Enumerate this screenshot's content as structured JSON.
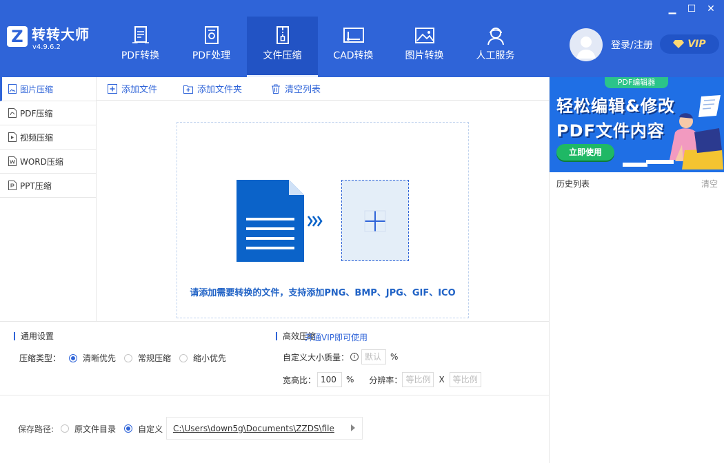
{
  "app": {
    "title": "转转大师",
    "version": "v4.9.6.2",
    "logo_letter": "Z"
  },
  "window_controls": {
    "minimize": "▁",
    "maximize": "☐",
    "close": "✕"
  },
  "nav": [
    {
      "label": "PDF转换",
      "icon": "pdf-convert-icon"
    },
    {
      "label": "PDF处理",
      "icon": "pdf-process-icon"
    },
    {
      "label": "文件压缩",
      "icon": "file-compress-icon",
      "active": true
    },
    {
      "label": "CAD转换",
      "icon": "cad-icon"
    },
    {
      "label": "图片转换",
      "icon": "image-convert-icon"
    },
    {
      "label": "人工服务",
      "icon": "service-icon"
    }
  ],
  "user": {
    "login_label": "登录/注册",
    "vip_label": "VIP"
  },
  "sidebar": [
    {
      "label": "图片压缩",
      "active": true
    },
    {
      "label": "PDF压缩"
    },
    {
      "label": "视频压缩"
    },
    {
      "label": "WORD压缩"
    },
    {
      "label": "PPT压缩"
    }
  ],
  "toolbar": {
    "add_file": "添加文件",
    "add_folder": "添加文件夹",
    "clear_list": "清空列表"
  },
  "dropzone": {
    "hint": "请添加需要转换的文件，支持添加PNG、BMP、JPG、GIF、ICO"
  },
  "settings": {
    "general_title": "通用设置",
    "compress_type_label": "压缩类型：",
    "options": [
      "清晰优先",
      "常规压缩",
      "缩小优先"
    ],
    "selected_option": "清晰优先",
    "efficient_title": "高效压缩",
    "vip_link": "开通VIP即可使用",
    "custom_size_label": "自定义大小质量：",
    "custom_size_placeholder": "默认",
    "percent": "%",
    "ratio_label": "宽高比：",
    "ratio_value": "100",
    "resolution_label": "分辨率：",
    "res_placeholder_w": "等比例",
    "res_x": "X",
    "res_placeholder_h": "等比例"
  },
  "save": {
    "label": "保存路径:",
    "option_original": "原文件目录",
    "option_custom": "自定义",
    "selected": "自定义",
    "path": "C:\\Users\\down5g\\Documents\\ZZDS\\file"
  },
  "banner": {
    "tag": "PDF编辑器",
    "line1": "轻松编辑&修改",
    "line2": "PDF文件内容",
    "button": "立即使用"
  },
  "history": {
    "title": "历史列表",
    "clear": "清空"
  },
  "colors": {
    "primary": "#2f64d8",
    "header": "#2f64d8",
    "doc_blue": "#0b63c9",
    "banner_green": "#1fb865"
  }
}
